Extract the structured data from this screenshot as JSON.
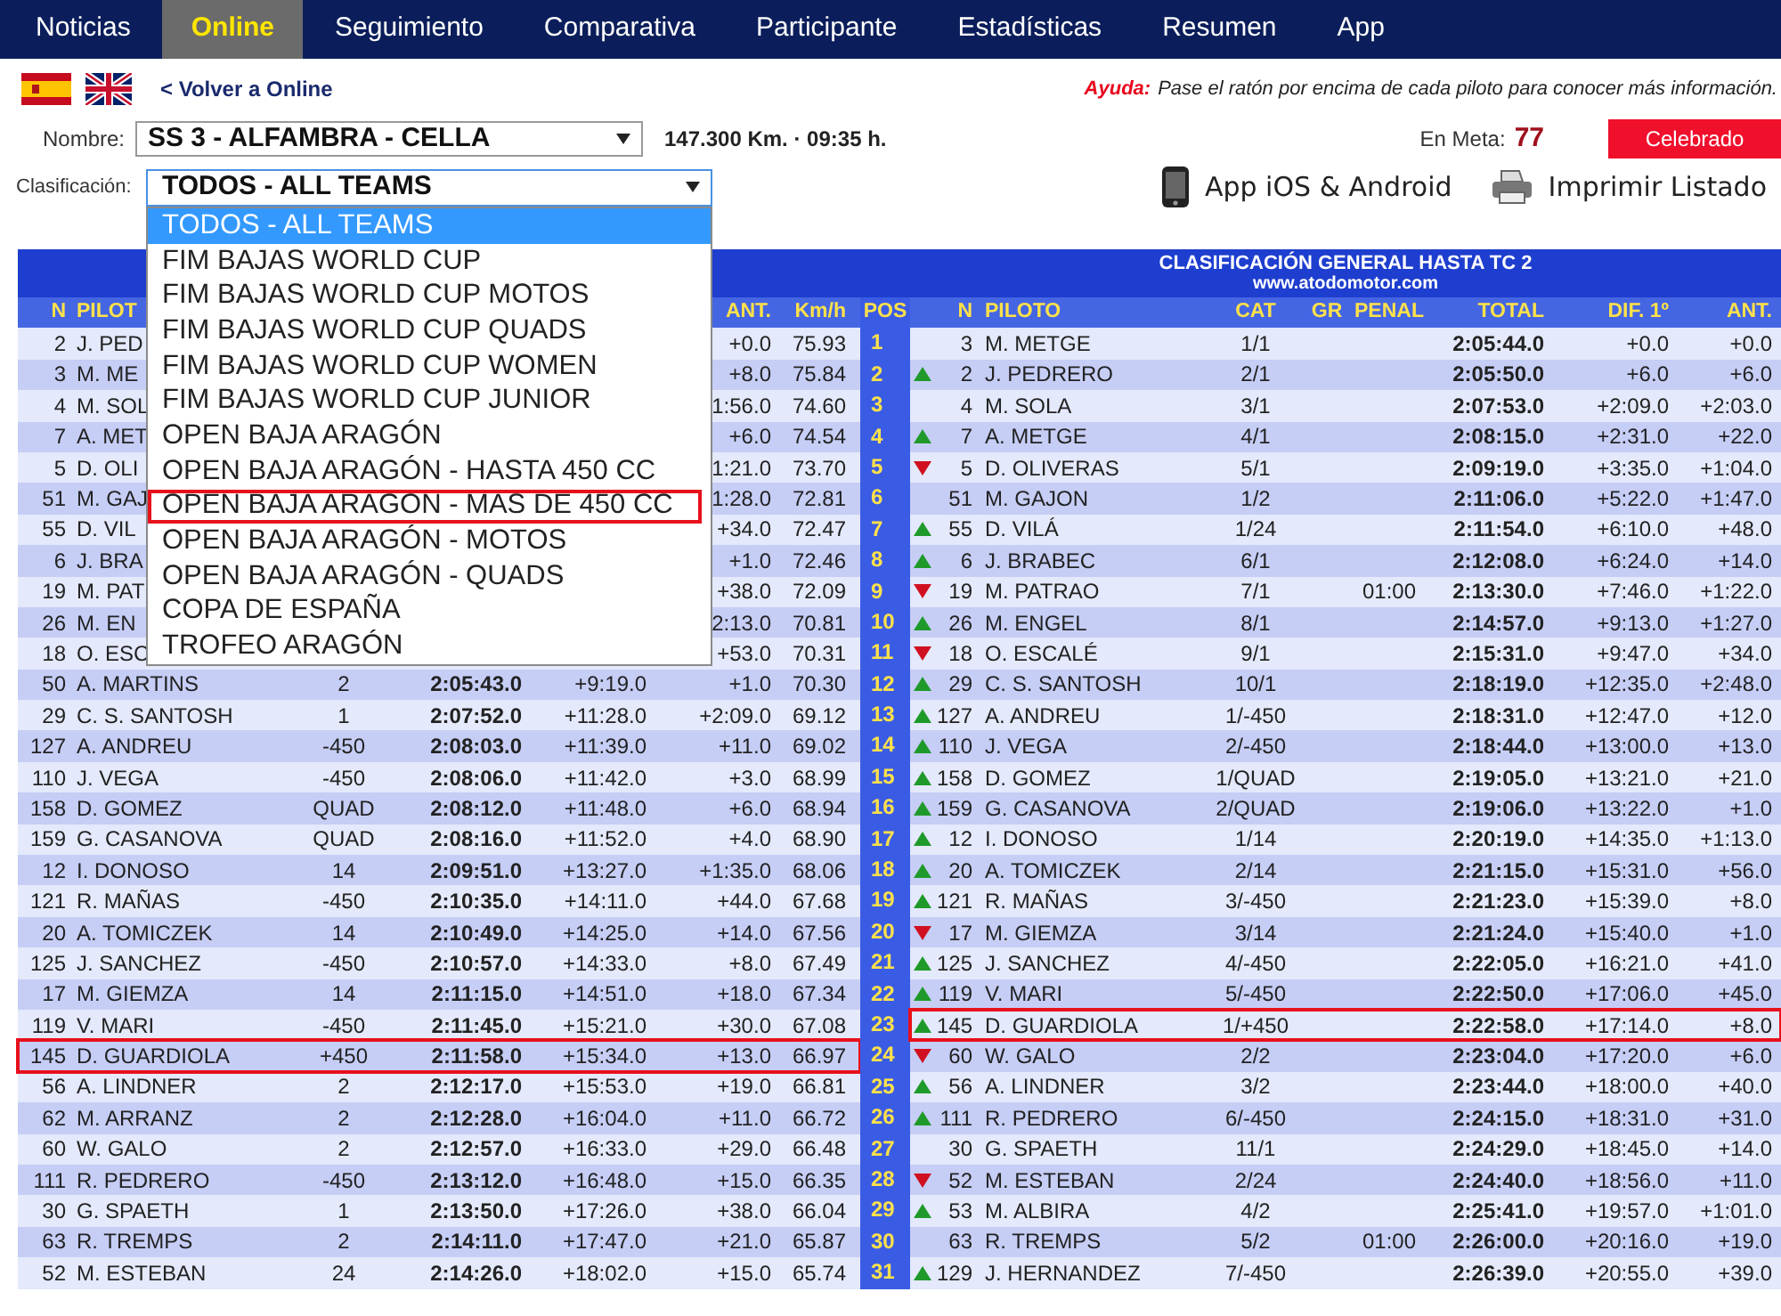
{
  "nav": [
    {
      "label": "Noticias",
      "selected": false
    },
    {
      "label": "Online",
      "selected": true
    },
    {
      "label": "Seguimiento",
      "selected": false
    },
    {
      "label": "Comparativa",
      "selected": false
    },
    {
      "label": "Participante",
      "selected": false
    },
    {
      "label": "Estadísticas",
      "selected": false
    },
    {
      "label": "Resumen",
      "selected": false
    },
    {
      "label": "App",
      "selected": false
    }
  ],
  "flags": [
    {
      "kind": "spain"
    },
    {
      "kind": "uk"
    }
  ],
  "back_link": "< Volver a Online",
  "help": {
    "label": "Ayuda:",
    "text": "Pase el ratón por encima de cada piloto para conocer más información."
  },
  "stage_field": {
    "label": "Nombre:",
    "value": "SS 3 - ALFAMBRA - CELLA"
  },
  "stage_info": "147.300 Km. · 09:35 h.",
  "finished": {
    "label": "En Meta:",
    "count": "77"
  },
  "status_button": "Celebrado",
  "class_field": {
    "label": "Clasificación:",
    "value": "TODOS - ALL TEAMS",
    "focused": true
  },
  "app_link": "App iOS & Android",
  "print_link": "Imprimir Listado",
  "dropdown": {
    "options": [
      {
        "label": "TODOS - ALL TEAMS",
        "selected": true,
        "highlighted": false
      },
      {
        "label": "FIM BAJAS WORLD CUP",
        "selected": false,
        "highlighted": false
      },
      {
        "label": "FIM BAJAS WORLD CUP MOTOS",
        "selected": false,
        "highlighted": false
      },
      {
        "label": "FIM BAJAS WORLD CUP QUADS",
        "selected": false,
        "highlighted": false
      },
      {
        "label": "FIM BAJAS WORLD CUP WOMEN",
        "selected": false,
        "highlighted": false
      },
      {
        "label": "FIM BAJAS WORLD CUP JUNIOR",
        "selected": false,
        "highlighted": false
      },
      {
        "label": "OPEN BAJA ARAGÓN",
        "selected": false,
        "highlighted": false
      },
      {
        "label": "OPEN BAJA ARAGÓN - HASTA 450 CC",
        "selected": false,
        "highlighted": false
      },
      {
        "label": "OPEN BAJA ARAGON - MAS DE 450 CC",
        "selected": false,
        "highlighted": true
      },
      {
        "label": "OPEN BAJA ARAGÓN - MOTOS",
        "selected": false,
        "highlighted": false
      },
      {
        "label": "OPEN BAJA ARAGÓN - QUADS",
        "selected": false,
        "highlighted": false
      },
      {
        "label": "COPA DE ESPAÑA",
        "selected": false,
        "highlighted": false
      },
      {
        "label": "TROFEO ARAGÓN",
        "selected": false,
        "highlighted": false
      }
    ]
  },
  "stage_table": {
    "columns": {
      "n": "N",
      "name": "PILOT",
      "ant": "ANT.",
      "kmh": "Km/h"
    },
    "rows": [
      {
        "n": "2",
        "name": "J. PED",
        "ant": "+0.0",
        "kmh": "75.93",
        "highlighted": false
      },
      {
        "n": "3",
        "name": "M. ME",
        "ant": "+8.0",
        "kmh": "75.84",
        "highlighted": false
      },
      {
        "n": "4",
        "name": "M. SOL",
        "ant": "1:56.0",
        "kmh": "74.60",
        "highlighted": false
      },
      {
        "n": "7",
        "name": "A. MET",
        "ant": "+6.0",
        "kmh": "74.54",
        "highlighted": false
      },
      {
        "n": "5",
        "name": "D. OLI",
        "ant": "1:21.0",
        "kmh": "73.70",
        "highlighted": false
      },
      {
        "n": "51",
        "name": "M. GAJ",
        "ant": "1:28.0",
        "kmh": "72.81",
        "highlighted": false
      },
      {
        "n": "55",
        "name": "D. VIL",
        "ant": "+34.0",
        "kmh": "72.47",
        "highlighted": false
      },
      {
        "n": "6",
        "name": "J. BRA",
        "ant": "+1.0",
        "kmh": "72.46",
        "highlighted": false
      },
      {
        "n": "19",
        "name": "M. PAT",
        "ant": "+38.0",
        "kmh": "72.09",
        "highlighted": false
      },
      {
        "n": "26",
        "name": "M. EN",
        "ant": "2:13.0",
        "kmh": "70.81",
        "highlighted": false
      },
      {
        "n": "18",
        "name": "O. ESC",
        "ant": "+53.0",
        "kmh": "70.31",
        "highlighted": false
      },
      {
        "n": "50",
        "name": "A. MARTINS",
        "cat": "2",
        "total": "2:05:43.0",
        "dif": "+9:19.0",
        "ant": "+1.0",
        "kmh": "70.30",
        "highlighted": false
      },
      {
        "n": "29",
        "name": "C. S. SANTOSH",
        "cat": "1",
        "total": "2:07:52.0",
        "dif": "+11:28.0",
        "ant": "+2:09.0",
        "kmh": "69.12",
        "highlighted": false
      },
      {
        "n": "127",
        "name": "A. ANDREU",
        "cat": "-450",
        "total": "2:08:03.0",
        "dif": "+11:39.0",
        "ant": "+11.0",
        "kmh": "69.02",
        "highlighted": false
      },
      {
        "n": "110",
        "name": "J. VEGA",
        "cat": "-450",
        "total": "2:08:06.0",
        "dif": "+11:42.0",
        "ant": "+3.0",
        "kmh": "68.99",
        "highlighted": false
      },
      {
        "n": "158",
        "name": "D. GOMEZ",
        "cat": "QUAD",
        "total": "2:08:12.0",
        "dif": "+11:48.0",
        "ant": "+6.0",
        "kmh": "68.94",
        "highlighted": false
      },
      {
        "n": "159",
        "name": "G. CASANOVA",
        "cat": "QUAD",
        "total": "2:08:16.0",
        "dif": "+11:52.0",
        "ant": "+4.0",
        "kmh": "68.90",
        "highlighted": false
      },
      {
        "n": "12",
        "name": "I. DONOSO",
        "cat": "14",
        "total": "2:09:51.0",
        "dif": "+13:27.0",
        "ant": "+1:35.0",
        "kmh": "68.06",
        "highlighted": false
      },
      {
        "n": "121",
        "name": "R. MAÑAS",
        "cat": "-450",
        "total": "2:10:35.0",
        "dif": "+14:11.0",
        "ant": "+44.0",
        "kmh": "67.68",
        "highlighted": false
      },
      {
        "n": "20",
        "name": "A. TOMICZEK",
        "cat": "14",
        "total": "2:10:49.0",
        "dif": "+14:25.0",
        "ant": "+14.0",
        "kmh": "67.56",
        "highlighted": false
      },
      {
        "n": "125",
        "name": "J. SANCHEZ",
        "cat": "-450",
        "total": "2:10:57.0",
        "dif": "+14:33.0",
        "ant": "+8.0",
        "kmh": "67.49",
        "highlighted": false
      },
      {
        "n": "17",
        "name": "M. GIEMZA",
        "cat": "14",
        "total": "2:11:15.0",
        "dif": "+14:51.0",
        "ant": "+18.0",
        "kmh": "67.34",
        "highlighted": false
      },
      {
        "n": "119",
        "name": "V. MARI",
        "cat": "-450",
        "total": "2:11:45.0",
        "dif": "+15:21.0",
        "ant": "+30.0",
        "kmh": "67.08",
        "highlighted": false
      },
      {
        "n": "145",
        "name": "D. GUARDIOLA",
        "cat": "+450",
        "total": "2:11:58.0",
        "dif": "+15:34.0",
        "ant": "+13.0",
        "kmh": "66.97",
        "highlighted": true
      },
      {
        "n": "56",
        "name": "A. LINDNER",
        "cat": "2",
        "total": "2:12:17.0",
        "dif": "+15:53.0",
        "ant": "+19.0",
        "kmh": "66.81",
        "highlighted": false
      },
      {
        "n": "62",
        "name": "M. ARRANZ",
        "cat": "2",
        "total": "2:12:28.0",
        "dif": "+16:04.0",
        "ant": "+11.0",
        "kmh": "66.72",
        "highlighted": false
      },
      {
        "n": "60",
        "name": "W. GALO",
        "cat": "2",
        "total": "2:12:57.0",
        "dif": "+16:33.0",
        "ant": "+29.0",
        "kmh": "66.48",
        "highlighted": false
      },
      {
        "n": "111",
        "name": "R. PEDRERO",
        "cat": "-450",
        "total": "2:13:12.0",
        "dif": "+16:48.0",
        "ant": "+15.0",
        "kmh": "66.35",
        "highlighted": false
      },
      {
        "n": "30",
        "name": "G. SPAETH",
        "cat": "1",
        "total": "2:13:50.0",
        "dif": "+17:26.0",
        "ant": "+38.0",
        "kmh": "66.04",
        "highlighted": false
      },
      {
        "n": "63",
        "name": "R. TREMPS",
        "cat": "2",
        "total": "2:14:11.0",
        "dif": "+17:47.0",
        "ant": "+21.0",
        "kmh": "65.87",
        "highlighted": false
      },
      {
        "n": "52",
        "name": "M. ESTEBAN",
        "cat": "24",
        "total": "2:14:26.0",
        "dif": "+18:02.0",
        "ant": "+15.0",
        "kmh": "65.74",
        "highlighted": false
      }
    ]
  },
  "positions": {
    "header": "POS",
    "values": [
      "1",
      "2",
      "3",
      "4",
      "5",
      "6",
      "7",
      "8",
      "9",
      "10",
      "11",
      "12",
      "13",
      "14",
      "15",
      "16",
      "17",
      "18",
      "19",
      "20",
      "21",
      "22",
      "23",
      "24",
      "25",
      "26",
      "27",
      "28",
      "29",
      "30",
      "31"
    ]
  },
  "general_table": {
    "title": "CLASIFICACIÓN GENERAL HASTA TC 2",
    "subtitle": "www.atodomotor.com",
    "columns": {
      "n": "N",
      "name": "PILOTO",
      "cat": "CAT",
      "gr": "GR",
      "penal": "PENAL",
      "total": "TOTAL",
      "dif": "DIF. 1º",
      "ant": "ANT."
    },
    "rows": [
      {
        "kind": "none",
        "n": "3",
        "name": "M. METGE",
        "cat": "1/1",
        "total": "2:05:44.0",
        "dif": "+0.0",
        "ant": "+0.0",
        "highlighted": false
      },
      {
        "kind": "up",
        "n": "2",
        "name": "J. PEDRERO",
        "cat": "2/1",
        "total": "2:05:50.0",
        "dif": "+6.0",
        "ant": "+6.0",
        "highlighted": false
      },
      {
        "kind": "none",
        "n": "4",
        "name": "M. SOLA",
        "cat": "3/1",
        "total": "2:07:53.0",
        "dif": "+2:09.0",
        "ant": "+2:03.0",
        "highlighted": false
      },
      {
        "kind": "up",
        "n": "7",
        "name": "A. METGE",
        "cat": "4/1",
        "total": "2:08:15.0",
        "dif": "+2:31.0",
        "ant": "+22.0",
        "highlighted": false
      },
      {
        "kind": "down",
        "n": "5",
        "name": "D. OLIVERAS",
        "cat": "5/1",
        "total": "2:09:19.0",
        "dif": "+3:35.0",
        "ant": "+1:04.0",
        "highlighted": false
      },
      {
        "kind": "none",
        "n": "51",
        "name": "M. GAJON",
        "cat": "1/2",
        "total": "2:11:06.0",
        "dif": "+5:22.0",
        "ant": "+1:47.0",
        "highlighted": false
      },
      {
        "kind": "up",
        "n": "55",
        "name": "D. VILÁ",
        "cat": "1/24",
        "total": "2:11:54.0",
        "dif": "+6:10.0",
        "ant": "+48.0",
        "highlighted": false
      },
      {
        "kind": "up",
        "n": "6",
        "name": "J. BRABEC",
        "cat": "6/1",
        "total": "2:12:08.0",
        "dif": "+6:24.0",
        "ant": "+14.0",
        "highlighted": false
      },
      {
        "kind": "down",
        "n": "19",
        "name": "M. PATRAO",
        "cat": "7/1",
        "penal": "01:00",
        "total": "2:13:30.0",
        "dif": "+7:46.0",
        "ant": "+1:22.0",
        "highlighted": false
      },
      {
        "kind": "up",
        "n": "26",
        "name": "M. ENGEL",
        "cat": "8/1",
        "total": "2:14:57.0",
        "dif": "+9:13.0",
        "ant": "+1:27.0",
        "highlighted": false
      },
      {
        "kind": "down",
        "n": "18",
        "name": "O. ESCALÉ",
        "cat": "9/1",
        "total": "2:15:31.0",
        "dif": "+9:47.0",
        "ant": "+34.0",
        "highlighted": false
      },
      {
        "kind": "up",
        "n": "29",
        "name": "C. S. SANTOSH",
        "cat": "10/1",
        "total": "2:18:19.0",
        "dif": "+12:35.0",
        "ant": "+2:48.0",
        "highlighted": false
      },
      {
        "kind": "up",
        "n": "127",
        "name": "A. ANDREU",
        "cat": "1/-450",
        "total": "2:18:31.0",
        "dif": "+12:47.0",
        "ant": "+12.0",
        "highlighted": false
      },
      {
        "kind": "up",
        "n": "110",
        "name": "J. VEGA",
        "cat": "2/-450",
        "total": "2:18:44.0",
        "dif": "+13:00.0",
        "ant": "+13.0",
        "highlighted": false
      },
      {
        "kind": "up",
        "n": "158",
        "name": "D. GOMEZ",
        "cat": "1/QUAD",
        "total": "2:19:05.0",
        "dif": "+13:21.0",
        "ant": "+21.0",
        "highlighted": false
      },
      {
        "kind": "up",
        "n": "159",
        "name": "G. CASANOVA",
        "cat": "2/QUAD",
        "total": "2:19:06.0",
        "dif": "+13:22.0",
        "ant": "+1.0",
        "highlighted": false
      },
      {
        "kind": "up",
        "n": "12",
        "name": "I. DONOSO",
        "cat": "1/14",
        "total": "2:20:19.0",
        "dif": "+14:35.0",
        "ant": "+1:13.0",
        "highlighted": false
      },
      {
        "kind": "up",
        "n": "20",
        "name": "A. TOMICZEK",
        "cat": "2/14",
        "total": "2:21:15.0",
        "dif": "+15:31.0",
        "ant": "+56.0",
        "highlighted": false
      },
      {
        "kind": "up",
        "n": "121",
        "name": "R. MAÑAS",
        "cat": "3/-450",
        "total": "2:21:23.0",
        "dif": "+15:39.0",
        "ant": "+8.0",
        "highlighted": false
      },
      {
        "kind": "down",
        "n": "17",
        "name": "M. GIEMZA",
        "cat": "3/14",
        "total": "2:21:24.0",
        "dif": "+15:40.0",
        "ant": "+1.0",
        "highlighted": false
      },
      {
        "kind": "up",
        "n": "125",
        "name": "J. SANCHEZ",
        "cat": "4/-450",
        "total": "2:22:05.0",
        "dif": "+16:21.0",
        "ant": "+41.0",
        "highlighted": false
      },
      {
        "kind": "up",
        "n": "119",
        "name": "V. MARI",
        "cat": "5/-450",
        "total": "2:22:50.0",
        "dif": "+17:06.0",
        "ant": "+45.0",
        "highlighted": false
      },
      {
        "kind": "up",
        "n": "145",
        "name": "D. GUARDIOLA",
        "cat": "1/+450",
        "total": "2:22:58.0",
        "dif": "+17:14.0",
        "ant": "+8.0",
        "highlighted": true
      },
      {
        "kind": "down",
        "n": "60",
        "name": "W. GALO",
        "cat": "2/2",
        "total": "2:23:04.0",
        "dif": "+17:20.0",
        "ant": "+6.0",
        "highlighted": false
      },
      {
        "kind": "up",
        "n": "56",
        "name": "A. LINDNER",
        "cat": "3/2",
        "total": "2:23:44.0",
        "dif": "+18:00.0",
        "ant": "+40.0",
        "highlighted": false
      },
      {
        "kind": "up",
        "n": "111",
        "name": "R. PEDRERO",
        "cat": "6/-450",
        "total": "2:24:15.0",
        "dif": "+18:31.0",
        "ant": "+31.0",
        "highlighted": false
      },
      {
        "kind": "none",
        "n": "30",
        "name": "G. SPAETH",
        "cat": "11/1",
        "total": "2:24:29.0",
        "dif": "+18:45.0",
        "ant": "+14.0",
        "highlighted": false
      },
      {
        "kind": "down",
        "n": "52",
        "name": "M. ESTEBAN",
        "cat": "2/24",
        "total": "2:24:40.0",
        "dif": "+18:56.0",
        "ant": "+11.0",
        "highlighted": false
      },
      {
        "kind": "up",
        "n": "53",
        "name": "M. ALBIRA",
        "cat": "4/2",
        "total": "2:25:41.0",
        "dif": "+19:57.0",
        "ant": "+1:01.0",
        "highlighted": false
      },
      {
        "kind": "none",
        "n": "63",
        "name": "R. TREMPS",
        "cat": "5/2",
        "penal": "01:00",
        "total": "2:26:00.0",
        "dif": "+20:16.0",
        "ant": "+19.0",
        "highlighted": false
      },
      {
        "kind": "up",
        "n": "129",
        "name": "J. HERNANDEZ",
        "cat": "7/-450",
        "total": "2:26:39.0",
        "dif": "+20:55.0",
        "ant": "+39.0",
        "highlighted": false
      }
    ]
  }
}
